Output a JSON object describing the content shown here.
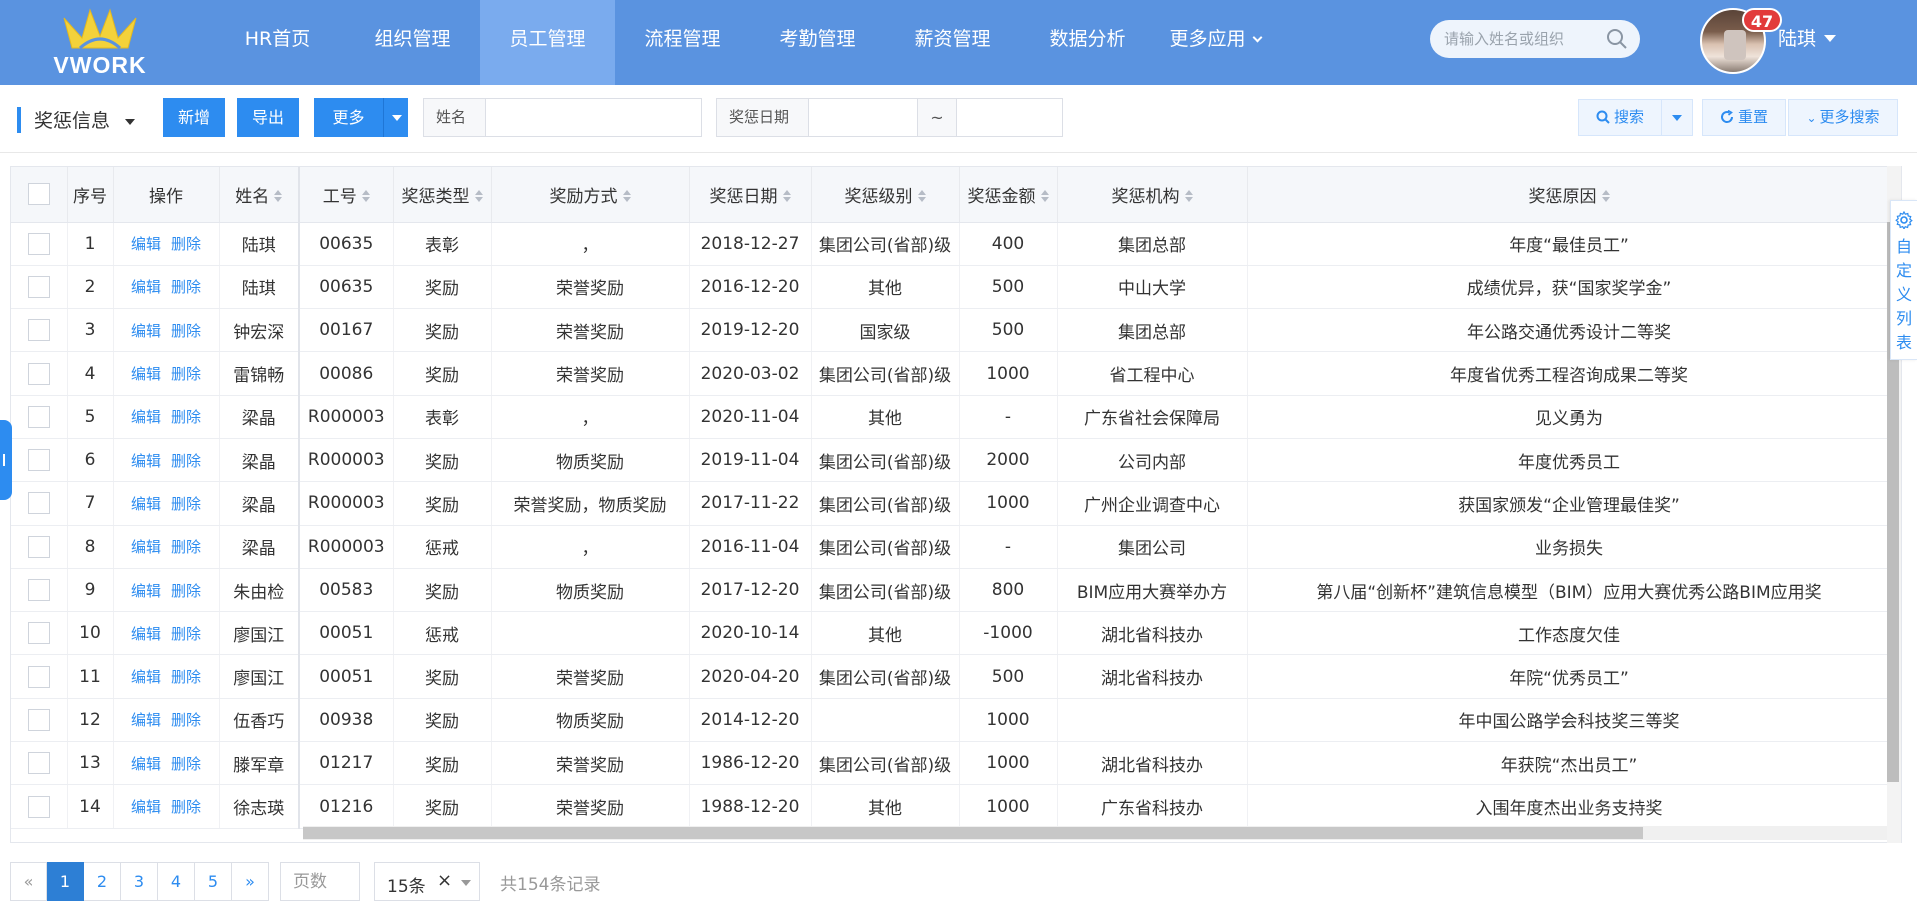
{
  "logo": {
    "text": "VWORK"
  },
  "nav": {
    "items": [
      {
        "label": "HR首页"
      },
      {
        "label": "组织管理"
      },
      {
        "label": "员工管理"
      },
      {
        "label": "流程管理"
      },
      {
        "label": "考勤管理"
      },
      {
        "label": "薪资管理"
      },
      {
        "label": "数据分析"
      },
      {
        "label": "更多应用"
      }
    ],
    "active_index": 2
  },
  "search": {
    "placeholder": "请输入姓名或组织"
  },
  "user": {
    "name": "陆琪",
    "badge": "47"
  },
  "toolbar": {
    "section_title": "奖惩信息",
    "add_label": "新增",
    "export_label": "导出",
    "more_label": "更多",
    "name_label": "姓名",
    "name_value": "",
    "date_label": "奖惩日期",
    "date_separator": "~",
    "date_from": "",
    "date_to": "",
    "search_label": "搜索",
    "reset_label": "重置",
    "more_search_label": "更多搜索"
  },
  "table": {
    "columns": [
      "序号",
      "操作",
      "姓名",
      "工号",
      "奖惩类型",
      "奖励方式",
      "奖惩日期",
      "奖惩级别",
      "奖惩金额",
      "奖惩机构",
      "奖惩原因"
    ],
    "edit_label": "编辑",
    "delete_label": "删除",
    "rows": [
      {
        "no": "1",
        "name": "陆琪",
        "id": "00635",
        "type": "表彰",
        "method": "，",
        "date": "2018-12-27",
        "level": "集团公司(省部)级",
        "amount": "400",
        "org": "集团总部",
        "reason": "年度“最佳员工”"
      },
      {
        "no": "2",
        "name": "陆琪",
        "id": "00635",
        "type": "奖励",
        "method": "荣誉奖励",
        "date": "2016-12-20",
        "level": "其他",
        "amount": "500",
        "org": "中山大学",
        "reason": "成绩优异，获“国家奖学金”"
      },
      {
        "no": "3",
        "name": "钟宏深",
        "id": "00167",
        "type": "奖励",
        "method": "荣誉奖励",
        "date": "2019-12-20",
        "level": "国家级",
        "amount": "500",
        "org": "集团总部",
        "reason": "年公路交通优秀设计二等奖"
      },
      {
        "no": "4",
        "name": "雷锦畅",
        "id": "00086",
        "type": "奖励",
        "method": "荣誉奖励",
        "date": "2020-03-02",
        "level": "集团公司(省部)级",
        "amount": "1000",
        "org": "省工程中心",
        "reason": "年度省优秀工程咨询成果二等奖"
      },
      {
        "no": "5",
        "name": "梁晶",
        "id": "R000003",
        "type": "表彰",
        "method": "，",
        "date": "2020-11-04",
        "level": "其他",
        "amount": "-",
        "org": "广东省社会保障局",
        "reason": "见义勇为"
      },
      {
        "no": "6",
        "name": "梁晶",
        "id": "R000003",
        "type": "奖励",
        "method": "物质奖励",
        "date": "2019-11-04",
        "level": "集团公司(省部)级",
        "amount": "2000",
        "org": "公司内部",
        "reason": "年度优秀员工"
      },
      {
        "no": "7",
        "name": "梁晶",
        "id": "R000003",
        "type": "奖励",
        "method": "荣誉奖励，物质奖励",
        "date": "2017-11-22",
        "level": "集团公司(省部)级",
        "amount": "1000",
        "org": "广州企业调查中心",
        "reason": "获国家颁发“企业管理最佳奖”"
      },
      {
        "no": "8",
        "name": "梁晶",
        "id": "R000003",
        "type": "惩戒",
        "method": "，",
        "date": "2016-11-04",
        "level": "集团公司(省部)级",
        "amount": "-",
        "org": "集团公司",
        "reason": "业务损失"
      },
      {
        "no": "9",
        "name": "朱由检",
        "id": "00583",
        "type": "奖励",
        "method": "物质奖励",
        "date": "2017-12-20",
        "level": "集团公司(省部)级",
        "amount": "800",
        "org": "BIM应用大赛举办方",
        "reason": "第八届“创新杯”建筑信息模型（BIM）应用大赛优秀公路BIM应用奖"
      },
      {
        "no": "10",
        "name": "廖国江",
        "id": "00051",
        "type": "惩戒",
        "method": "",
        "date": "2020-10-14",
        "level": "其他",
        "amount": "-1000",
        "org": "湖北省科技办",
        "reason": "工作态度欠佳"
      },
      {
        "no": "11",
        "name": "廖国江",
        "id": "00051",
        "type": "奖励",
        "method": "荣誉奖励",
        "date": "2020-04-20",
        "level": "集团公司(省部)级",
        "amount": "500",
        "org": "湖北省科技办",
        "reason": "年院“优秀员工”"
      },
      {
        "no": "12",
        "name": "伍香巧",
        "id": "00938",
        "type": "奖励",
        "method": "物质奖励",
        "date": "2014-12-20",
        "level": "",
        "amount": "1000",
        "org": "",
        "reason": "年中国公路学会科技奖三等奖"
      },
      {
        "no": "13",
        "name": "滕军章",
        "id": "01217",
        "type": "奖励",
        "method": "荣誉奖励",
        "date": "1986-12-20",
        "level": "集团公司(省部)级",
        "amount": "1000",
        "org": "湖北省科技办",
        "reason": "年获院“杰出员工”"
      },
      {
        "no": "14",
        "name": "徐志瑛",
        "id": "01216",
        "type": "奖励",
        "method": "荣誉奖励",
        "date": "1988-12-20",
        "level": "其他",
        "amount": "1000",
        "org": "广东省科技办",
        "reason": "入围年度杰出业务支持奖"
      }
    ]
  },
  "side_panel": {
    "label": "自定义列表"
  },
  "pagination": {
    "prev": "«",
    "next": "»",
    "pages": [
      "1",
      "2",
      "3",
      "4",
      "5"
    ],
    "current": "1",
    "page_input_placeholder": "页数",
    "page_size": "15条",
    "page_size_clear": "×",
    "total_text": "共154条记录"
  },
  "colors": {
    "nav_bg": "#5a93e0",
    "nav_active": "#7aabee",
    "primary": "#2d8cf0",
    "badge": "#e23b3b"
  },
  "icons": [
    "search-icon",
    "refresh-icon",
    "chevron-down-icon",
    "gear-icon",
    "caret-down-icon"
  ]
}
